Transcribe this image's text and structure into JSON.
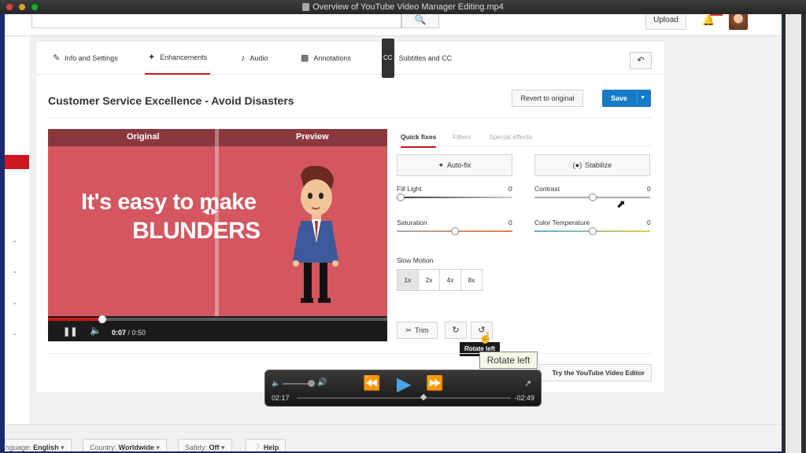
{
  "window": {
    "title": "Overview of YouTube Video Manager Editing.mp4"
  },
  "header": {
    "upload_label": "Upload"
  },
  "tabs": [
    {
      "label": "Info and Settings",
      "icon": "pencil-icon"
    },
    {
      "label": "Enhancements",
      "icon": "magic-wand-icon"
    },
    {
      "label": "Audio",
      "icon": "music-note-icon"
    },
    {
      "label": "Annotations",
      "icon": "speech-bubble-icon"
    },
    {
      "label": "Subtitles and CC",
      "icon": "cc-icon"
    }
  ],
  "editor": {
    "video_title": "Customer Service Excellence - Avoid Disasters",
    "revert_label": "Revert to original",
    "save_label": "Save"
  },
  "video": {
    "original_label": "Original",
    "preview_label": "Preview",
    "overlay_line1": "It's easy to make",
    "overlay_line2": "BLUNDERS",
    "current_time": "0:07",
    "duration": "/ 0:50",
    "progress_fraction": 0.16
  },
  "subtabs": [
    {
      "label": "Quick fixes"
    },
    {
      "label": "Filters"
    },
    {
      "label": "Special effects"
    }
  ],
  "quickfix": {
    "autofix_label": "Auto-fix",
    "stabilize_label": "Stabilize",
    "fill_light": {
      "label": "Fill Light",
      "value": "0",
      "position": 0.0
    },
    "contrast": {
      "label": "Contrast",
      "value": "0",
      "position": 0.5
    },
    "saturation": {
      "label": "Saturation",
      "value": "0",
      "position": 0.5
    },
    "color_temp": {
      "label": "Color Temperature",
      "value": "0",
      "position": 0.5
    },
    "slow_motion_label": "Slow Motion",
    "speeds": [
      "1x",
      "2x",
      "4x",
      "8x"
    ],
    "selected_speed": "1x",
    "trim_label": "Trim",
    "rotate_tooltip_dark": "Rotate left",
    "rotate_tooltip_light": "Rotate left"
  },
  "try_editor_label": "Try the YouTube Video Editor",
  "footer": {
    "language_prefix": "nguage:",
    "language_value": "English",
    "country_prefix": "Country:",
    "country_value": "Worldwide",
    "safety_prefix": "Safety:",
    "safety_value": "Off",
    "help_label": "Help"
  },
  "player": {
    "elapsed": "02:17",
    "remaining": "-02:49",
    "position": 0.58
  },
  "colors": {
    "accent": "#cc181e",
    "save_blue": "#167ac6",
    "video_bg": "#d4565f"
  }
}
